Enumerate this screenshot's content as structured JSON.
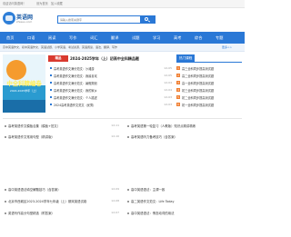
{
  "topbar": {
    "welcome": "欢迎访问英语网！",
    "links": [
      "设为首页",
      "加入收藏"
    ]
  },
  "header": {
    "logo_title": "英语网",
    "logo_domain": "zhiaeu.com",
    "search_placeholder": "请输入搜索关键字"
  },
  "nav": {
    "items": [
      "首页",
      "口语",
      "阅读",
      "写作",
      "词汇",
      "翻译",
      "试题",
      "学习",
      "高考",
      "综合",
      "专题"
    ]
  },
  "subnav": {
    "text": "高中英语作文、初中英语作文、英语试题、小学英语、考试资源、英语阅读、语法、翻译、写作",
    "more": "更多>>"
  },
  "banner": {
    "headline": "中全科精编卷",
    "sub": "2024-2025学年（上）"
  },
  "featured": {
    "badge": "精品",
    "title": "2024-2025学年（上）初高中全科精品题",
    "items": [
      {
        "text": "高考英语作文满分范文：沙滩游",
        "date": "12-05"
      },
      {
        "text": "高考英语作文满分范文：我最喜欢",
        "date": "12-05"
      },
      {
        "text": "高考英语作文满分范文：暑假规划",
        "date": "12-04"
      },
      {
        "text": "高考英语作文满分范文：我的家乡",
        "date": "12-04"
      },
      {
        "text": "高考英语作文满分范文：个人描述",
        "date": "12-03"
      },
      {
        "text": "2024高考英语作文范文（优秀）",
        "date": "12-03"
      },
      {
        "text": "高考英语作文满分范文：2024最新",
        "date": "12-02"
      }
    ]
  },
  "side": {
    "title": "热门课程",
    "items": [
      {
        "num": "1",
        "text": "高三全科同步提高测试题"
      },
      {
        "num": "2",
        "text": "高二全科同步提高测试题"
      },
      {
        "num": "3",
        "text": "高一全科同步提高测试题"
      },
      {
        "num": "4",
        "text": "初三全科同步提高测试题"
      },
      {
        "num": "5",
        "text": "初二全科同步提高测试题"
      },
      {
        "num": "6",
        "text": "初一全科同步提高测试题"
      }
    ]
  },
  "lower": {
    "left": [
      {
        "text": "高考英语作文模板合集（模板+范文）",
        "date": "12-11"
      },
      {
        "text": "高考英语作文常用句型（精讲版）",
        "date": "12-10"
      },
      {
        "text": "",
        "date": ""
      },
      {
        "text": "高中英语语法填空解题技巧（含答案）",
        "date": "12-09"
      },
      {
        "text": "北京市西城区2023-2024学年七年级（上）期末英语试卷",
        "date": "12-08"
      },
      {
        "text": "英语写作高分句型精选（附答案）",
        "date": "12-07"
      }
    ],
    "right": [
      {
        "text": "高考英语第一轮复习（人教版）知识点精讲精练",
        "date": ""
      },
      {
        "text": "高考英语听力备考技巧（含答案）",
        "date": ""
      },
      {
        "text": "",
        "date": ""
      },
      {
        "text": "高中英语语法：主谓一致",
        "date": ""
      },
      {
        "text": "高二英语作文范文：Life Today",
        "date": ""
      },
      {
        "text": "高中英语语法：情态动词的用法",
        "date": ""
      }
    ]
  }
}
